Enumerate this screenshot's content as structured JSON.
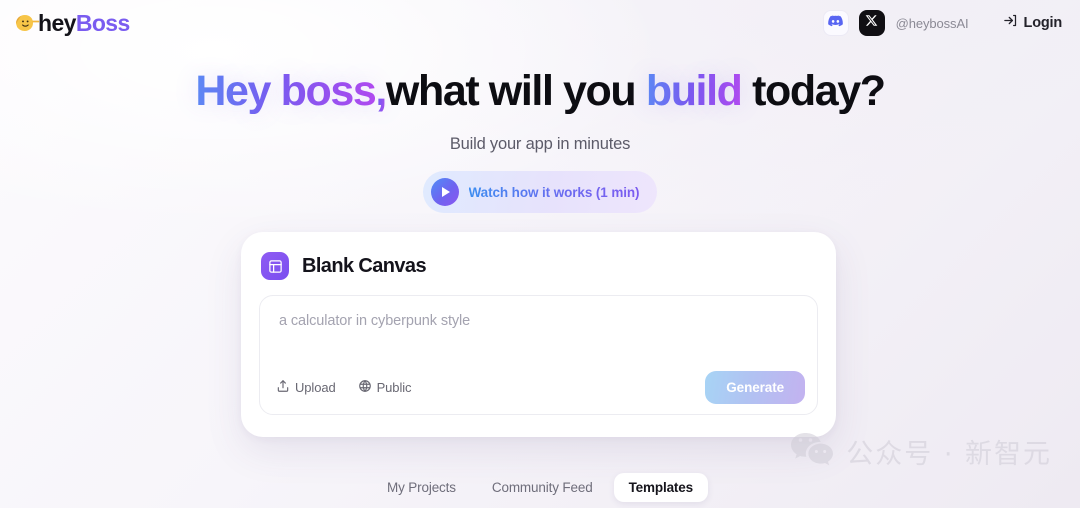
{
  "header": {
    "logo": {
      "icon": "pointing-hand-icon",
      "part1": "hey",
      "part2": "Boss"
    },
    "social": [
      {
        "name": "discord",
        "icon": "discord-icon"
      },
      {
        "name": "x-twitter",
        "icon": "x-icon"
      }
    ],
    "handle": "@heybossAI",
    "login": {
      "icon": "login-arrow-icon",
      "label": "Login"
    }
  },
  "hero": {
    "headline": {
      "part1": "Hey boss",
      "comma": ",",
      "part2": "what will you ",
      "part3": "build",
      "part4": " today?"
    },
    "subtitle": "Build your app in minutes",
    "watch_button": {
      "icon": "play-icon",
      "label": "Watch how it works (1 min)"
    }
  },
  "card": {
    "icon": "layout-panel-icon",
    "title": "Blank Canvas",
    "prompt_placeholder": "a calculator in cyberpunk style",
    "prompt_value": "",
    "actions": [
      {
        "name": "upload",
        "icon": "upload-icon",
        "label": "Upload"
      },
      {
        "name": "visibility",
        "icon": "globe-icon",
        "label": "Public"
      }
    ],
    "generate_label": "Generate"
  },
  "tabs": [
    {
      "label": "My Projects",
      "active": false
    },
    {
      "label": "Community Feed",
      "active": false
    },
    {
      "label": "Templates",
      "active": true
    }
  ],
  "watermark": {
    "icon": "wechat-icon",
    "text": "公众号 · 新智元"
  },
  "colors": {
    "brand_purple": "#7a5cf0",
    "gradient_start": "#5b8cf5",
    "gradient_end": "#b44af0",
    "text_dark": "#0d0d12",
    "text_muted": "#6f6e7b"
  }
}
